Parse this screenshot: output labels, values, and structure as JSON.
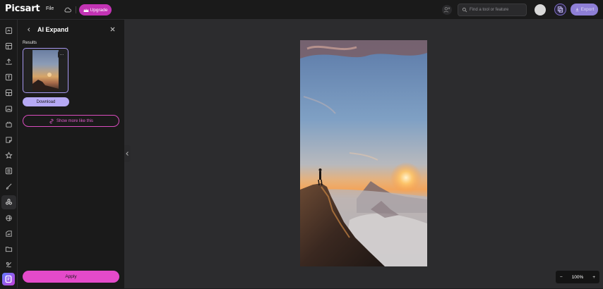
{
  "app": {
    "name": "Picsart"
  },
  "topbar": {
    "file_label": "File",
    "upgrade_label": "Upgrade",
    "search_placeholder": "Find a tool or feature",
    "export_label": "Export"
  },
  "sidebar": {
    "icons": [
      "ai-tools-icon",
      "templates-icon",
      "upload-icon",
      "text-icon",
      "layout-icon",
      "photos-icon",
      "elements-icon",
      "stickers-icon",
      "favorites-icon",
      "background-icon",
      "draw-icon",
      "ai-expand-icon",
      "effects-icon",
      "image-edit-icon",
      "folder-icon",
      "eraser-icon",
      "app-launcher-icon"
    ],
    "active": "ai-expand-icon"
  },
  "panel": {
    "title": "AI Expand",
    "results_label": "Results",
    "download_label": "Download",
    "more_label": "Show more like this",
    "apply_label": "Apply",
    "thumb_menu": "···"
  },
  "zoom": {
    "minus": "−",
    "value": "100%",
    "plus": "+"
  },
  "colors": {
    "brand_pink": "#e44aca",
    "accent_purple": "#b6a9f4",
    "canvas_bg": "#2c2c2e"
  }
}
